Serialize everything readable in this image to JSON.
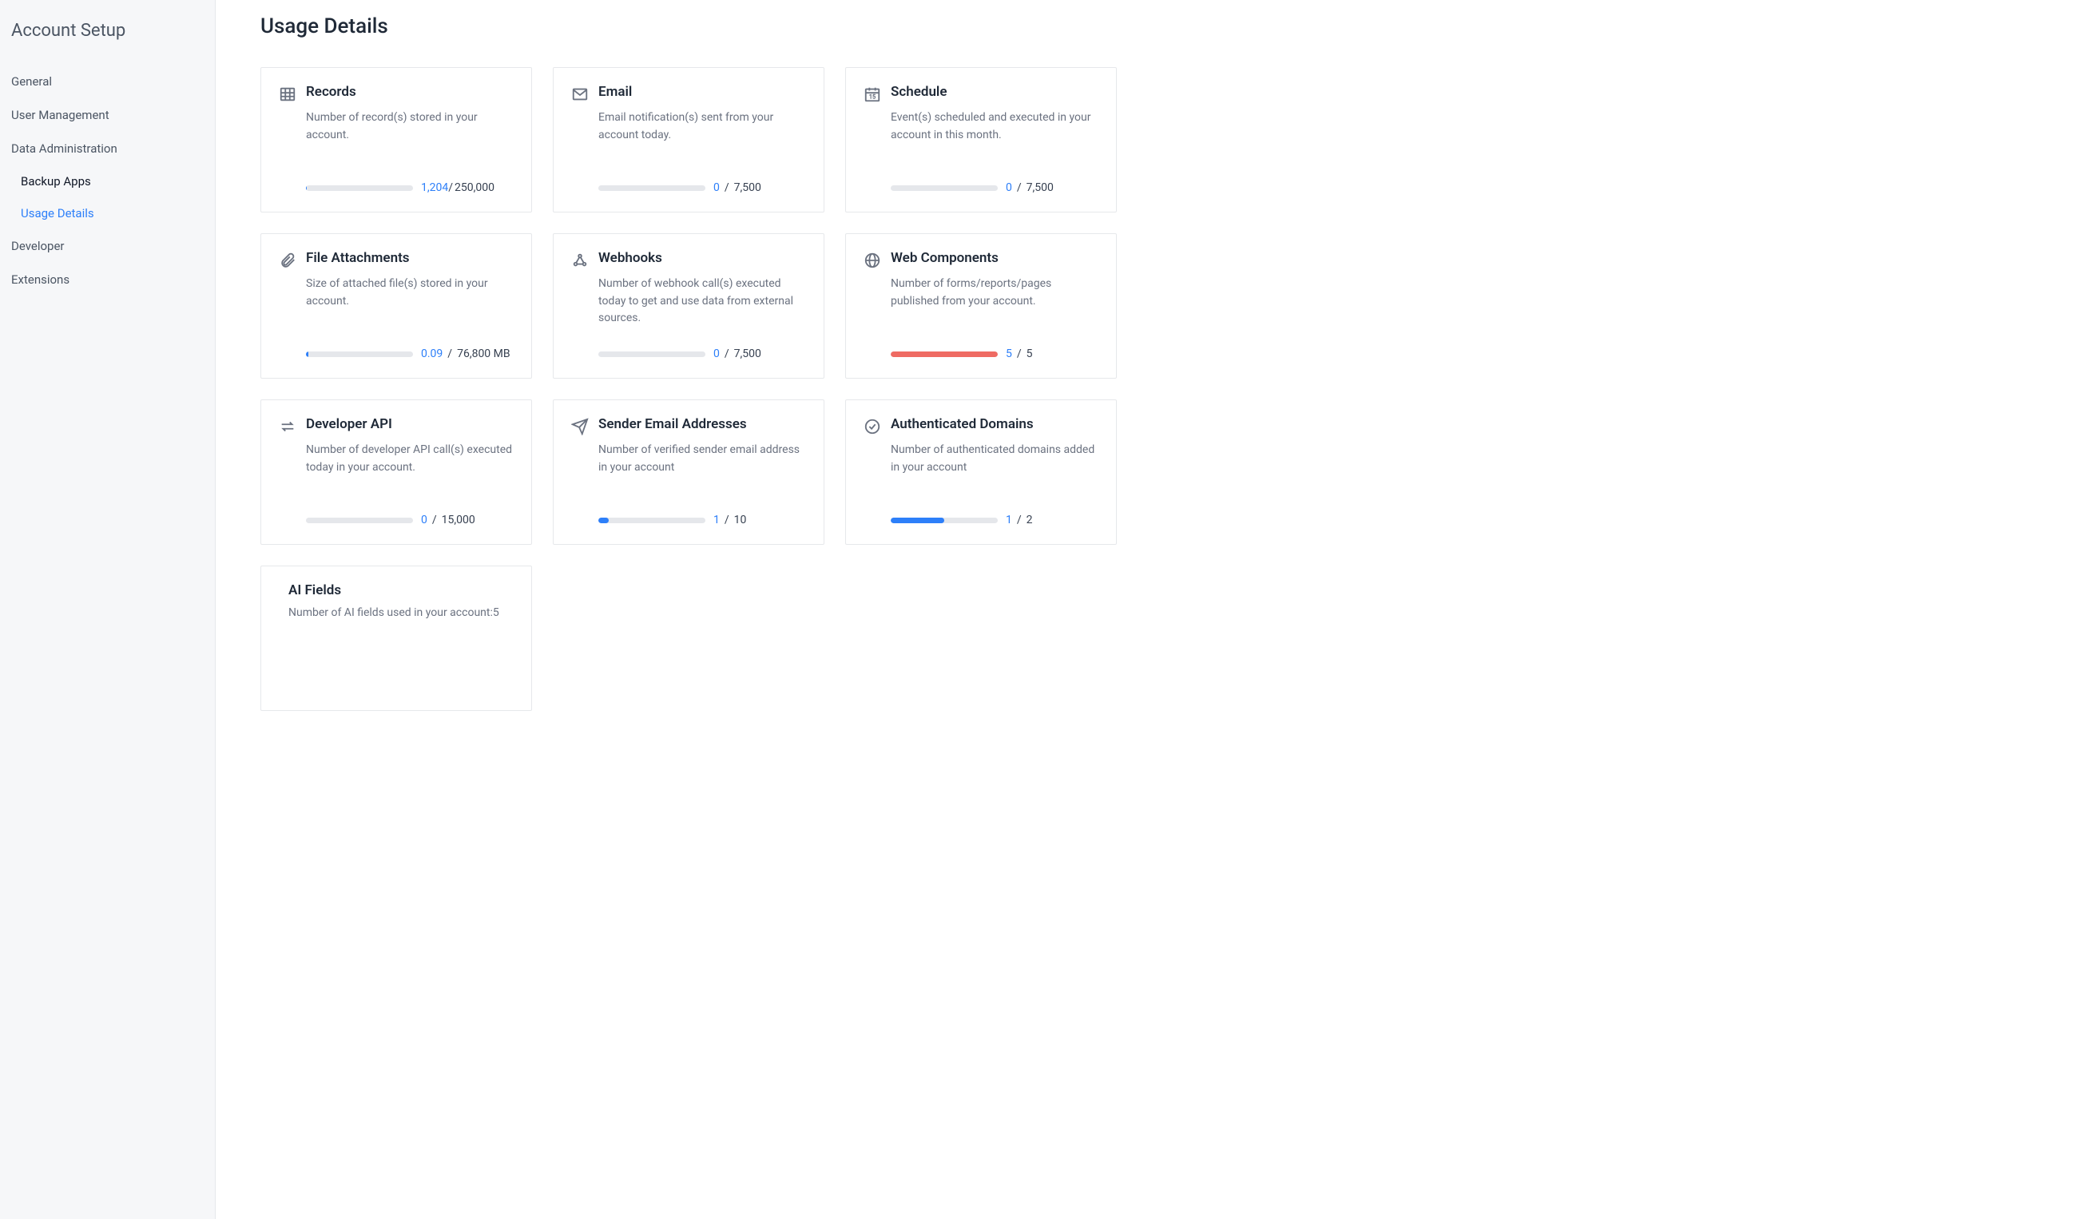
{
  "sidebar": {
    "title": "Account Setup",
    "items": [
      {
        "label": "General",
        "type": "top"
      },
      {
        "label": "User Management",
        "type": "top"
      },
      {
        "label": "Data Administration",
        "type": "top",
        "children": [
          {
            "label": "Backup Apps",
            "active": false
          },
          {
            "label": "Usage Details",
            "active": true
          }
        ]
      },
      {
        "label": "Developer",
        "type": "top"
      },
      {
        "label": "Extensions",
        "type": "top"
      }
    ]
  },
  "page": {
    "title": "Usage Details"
  },
  "cards": [
    {
      "id": "records",
      "icon": "table",
      "title": "Records",
      "desc": "Number of record(s) stored in your account.",
      "value": "1,204",
      "limit": "250,000",
      "sep": "/",
      "fill_pct": 0.5,
      "fill_color": "blue"
    },
    {
      "id": "email",
      "icon": "envelope",
      "title": "Email",
      "desc": "Email notification(s) sent from your account today.",
      "value": "0",
      "limit": "7,500",
      "sep": " / ",
      "fill_pct": 0,
      "fill_color": "blue"
    },
    {
      "id": "schedule",
      "icon": "calendar",
      "title": "Schedule",
      "desc": "Event(s) scheduled and executed in your account in this month.",
      "value": "0",
      "limit": "7,500",
      "sep": " / ",
      "fill_pct": 0,
      "fill_color": "blue"
    },
    {
      "id": "files",
      "icon": "paperclip",
      "title": "File Attachments",
      "desc": "Size of attached file(s) stored in your account.",
      "value": "0.09",
      "limit": "76,800 MB",
      "sep": " / ",
      "fill_pct": 2,
      "fill_color": "blue"
    },
    {
      "id": "webhooks",
      "icon": "webhook",
      "title": "Webhooks",
      "desc": "Number of webhook call(s) executed today to get and use data from external sources.",
      "value": "0",
      "limit": "7,500",
      "sep": " / ",
      "fill_pct": 0,
      "fill_color": "blue"
    },
    {
      "id": "webcomp",
      "icon": "globe",
      "title": "Web Components",
      "desc": "Number of forms/reports/pages published from your account.",
      "value": "5",
      "limit": "5",
      "sep": " / ",
      "fill_pct": 100,
      "fill_color": "red"
    },
    {
      "id": "devapi",
      "icon": "swap",
      "title": "Developer API",
      "desc": "Number of developer API call(s) executed today in your account.",
      "value": "0",
      "limit": "15,000",
      "sep": " / ",
      "fill_pct": 0,
      "fill_color": "blue"
    },
    {
      "id": "sender",
      "icon": "paper-plane",
      "title": "Sender Email Addresses",
      "desc": "Number of verified sender email address in your account",
      "value": "1",
      "limit": "10",
      "sep": " / ",
      "fill_pct": 10,
      "fill_color": "blue"
    },
    {
      "id": "authdom",
      "icon": "check-circle",
      "title": "Authenticated Domains",
      "desc": "Number of authenticated domains added in your account",
      "value": "1",
      "limit": "2",
      "sep": " / ",
      "fill_pct": 50,
      "fill_color": "blue"
    },
    {
      "id": "aifields",
      "icon": "",
      "title": "AI Fields",
      "desc": "Number of AI fields used in your account:5",
      "no_meter": true
    }
  ]
}
